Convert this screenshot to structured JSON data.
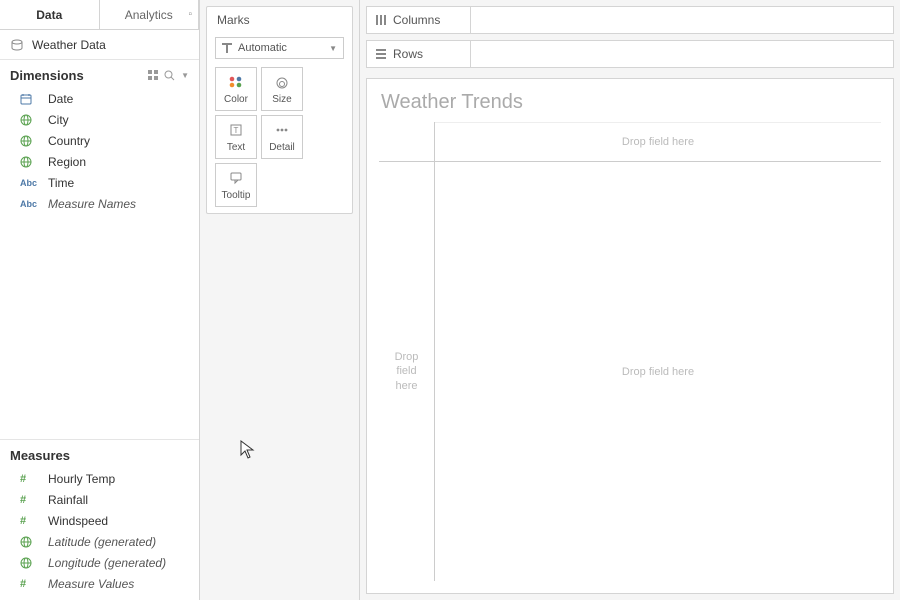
{
  "tabs": {
    "data": "Data",
    "analytics": "Analytics"
  },
  "datasource": {
    "name": "Weather Data"
  },
  "dimensions": {
    "header": "Dimensions",
    "items": [
      {
        "icon": "calendar",
        "label": "Date",
        "italic": false
      },
      {
        "icon": "globe",
        "label": "City",
        "italic": false
      },
      {
        "icon": "globe",
        "label": "Country",
        "italic": false
      },
      {
        "icon": "globe",
        "label": "Region",
        "italic": false
      },
      {
        "icon": "abc",
        "label": "Time",
        "italic": false
      },
      {
        "icon": "abc",
        "label": "Measure Names",
        "italic": true
      }
    ]
  },
  "measures": {
    "header": "Measures",
    "items": [
      {
        "icon": "hash",
        "label": "Hourly Temp",
        "italic": false
      },
      {
        "icon": "hash",
        "label": "Rainfall",
        "italic": false
      },
      {
        "icon": "hash",
        "label": "Windspeed",
        "italic": false
      },
      {
        "icon": "globe",
        "label": "Latitude (generated)",
        "italic": true
      },
      {
        "icon": "globe",
        "label": "Longitude (generated)",
        "italic": true
      },
      {
        "icon": "hash",
        "label": "Measure Values",
        "italic": true
      }
    ]
  },
  "marks": {
    "title": "Marks",
    "type_selected": "Automatic",
    "buttons": [
      {
        "key": "color",
        "label": "Color"
      },
      {
        "key": "size",
        "label": "Size"
      },
      {
        "key": "text",
        "label": "Text"
      },
      {
        "key": "detail",
        "label": "Detail"
      },
      {
        "key": "tooltip",
        "label": "Tooltip"
      }
    ]
  },
  "shelves": {
    "columns": "Columns",
    "rows": "Rows"
  },
  "viz": {
    "title": "Weather Trends",
    "drop_here": "Drop field here",
    "drop_here_multiline": "Drop\nfield\nhere"
  },
  "colors": {
    "dim_icon": "#4e79a7",
    "geo_icon": "#59a14f"
  }
}
